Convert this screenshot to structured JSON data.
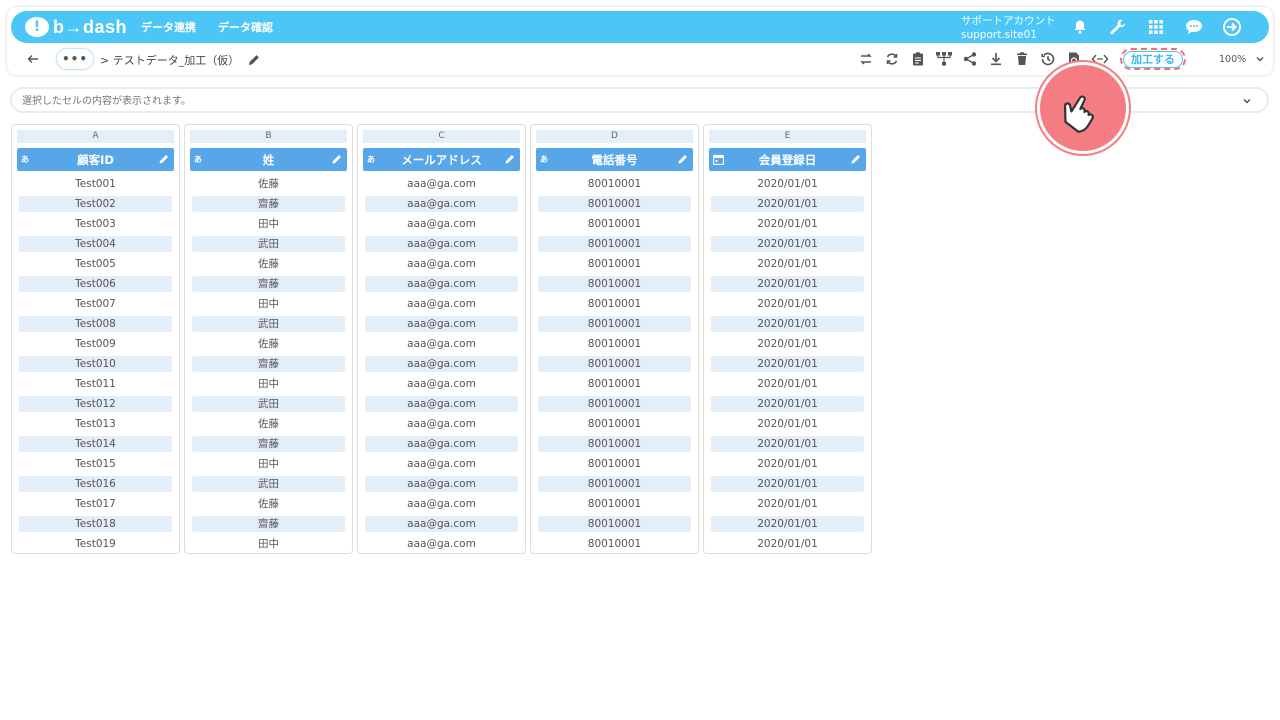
{
  "header": {
    "logo_mark": "!",
    "logo_text": "b→dash",
    "nav": [
      "データ連携",
      "データ確認"
    ],
    "account_line1": "サポートアカウント",
    "account_line2": "support.site01",
    "icons": [
      "bell-icon",
      "wrench-icon",
      "grid-apps-icon",
      "chat-bubble-icon",
      "logout-icon"
    ]
  },
  "toolbar": {
    "more_label": "•••",
    "breadcrumb": "> テストデータ_加工（仮）",
    "icons": [
      "swap-icon",
      "refresh-icon",
      "clipboard-icon",
      "hierarchy-icon",
      "share-icon",
      "download-icon",
      "trash-icon",
      "history-icon",
      "doc-refresh-icon",
      "code-icon"
    ],
    "process_label": "加工する",
    "zoom_value": "100%"
  },
  "cell_bar": {
    "placeholder": "選択したセルの内容が表示されます。"
  },
  "columns": [
    {
      "letter": "A",
      "type": "あ",
      "name": "顧客ID",
      "values": [
        "Test001",
        "Test002",
        "Test003",
        "Test004",
        "Test005",
        "Test006",
        "Test007",
        "Test008",
        "Test009",
        "Test010",
        "Test011",
        "Test012",
        "Test013",
        "Test014",
        "Test015",
        "Test016",
        "Test017",
        "Test018",
        "Test019"
      ]
    },
    {
      "letter": "B",
      "type": "あ",
      "name": "姓",
      "values": [
        "佐藤",
        "齋藤",
        "田中",
        "武田",
        "佐藤",
        "齋藤",
        "田中",
        "武田",
        "佐藤",
        "齋藤",
        "田中",
        "武田",
        "佐藤",
        "齋藤",
        "田中",
        "武田",
        "佐藤",
        "齋藤",
        "田中"
      ]
    },
    {
      "letter": "C",
      "type": "あ",
      "name": "メールアドレス",
      "values": [
        "aaa@ga.com",
        "aaa@ga.com",
        "aaa@ga.com",
        "aaa@ga.com",
        "aaa@ga.com",
        "aaa@ga.com",
        "aaa@ga.com",
        "aaa@ga.com",
        "aaa@ga.com",
        "aaa@ga.com",
        "aaa@ga.com",
        "aaa@ga.com",
        "aaa@ga.com",
        "aaa@ga.com",
        "aaa@ga.com",
        "aaa@ga.com",
        "aaa@ga.com",
        "aaa@ga.com",
        "aaa@ga.com"
      ]
    },
    {
      "letter": "D",
      "type": "あ",
      "name": "電話番号",
      "values": [
        "80010001",
        "80010001",
        "80010001",
        "80010001",
        "80010001",
        "80010001",
        "80010001",
        "80010001",
        "80010001",
        "80010001",
        "80010001",
        "80010001",
        "80010001",
        "80010001",
        "80010001",
        "80010001",
        "80010001",
        "80010001",
        "80010001"
      ]
    },
    {
      "letter": "E",
      "type": "calendar-icon",
      "name": "会員登録日",
      "values": [
        "2020/01/01",
        "2020/01/01",
        "2020/01/01",
        "2020/01/01",
        "2020/01/01",
        "2020/01/01",
        "2020/01/01",
        "2020/01/01",
        "2020/01/01",
        "2020/01/01",
        "2020/01/01",
        "2020/01/01",
        "2020/01/01",
        "2020/01/01",
        "2020/01/01",
        "2020/01/01",
        "2020/01/01",
        "2020/01/01",
        "2020/01/01"
      ]
    }
  ],
  "colors": {
    "header_bg": "#4cc6f6",
    "column_header_bg": "#57a6e8",
    "row_stripe": "#e3eef8",
    "highlight": "#f47d84"
  }
}
